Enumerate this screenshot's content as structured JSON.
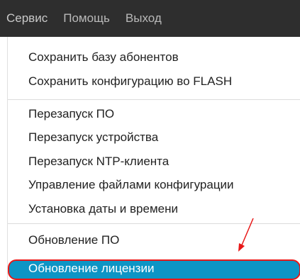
{
  "menubar": {
    "items": [
      {
        "label": "Сервис"
      },
      {
        "label": "Помощь"
      },
      {
        "label": "Выход"
      }
    ]
  },
  "dropdown": {
    "groups": [
      {
        "items": [
          {
            "label": "Сохранить базу абонентов"
          },
          {
            "label": "Сохранить конфигурацию во FLASH"
          }
        ]
      },
      {
        "items": [
          {
            "label": "Перезапуск ПО"
          },
          {
            "label": "Перезапуск устройства"
          },
          {
            "label": "Перезапуск NTP-клиента"
          },
          {
            "label": "Управление файлами конфигурации"
          },
          {
            "label": "Установка даты и времени"
          }
        ]
      },
      {
        "items": [
          {
            "label": "Обновление ПО"
          },
          {
            "label": "Обновление лицензии",
            "selected": true
          }
        ]
      }
    ]
  },
  "colors": {
    "menubar_bg": "#2e2e2e",
    "menubar_text": "#b9b9b9",
    "highlight_bg": "#0d95c5",
    "annotation": "#e81818"
  },
  "annotation": {
    "arrow_icon": "red-arrow-icon",
    "outline": "red-rounded-outline"
  }
}
